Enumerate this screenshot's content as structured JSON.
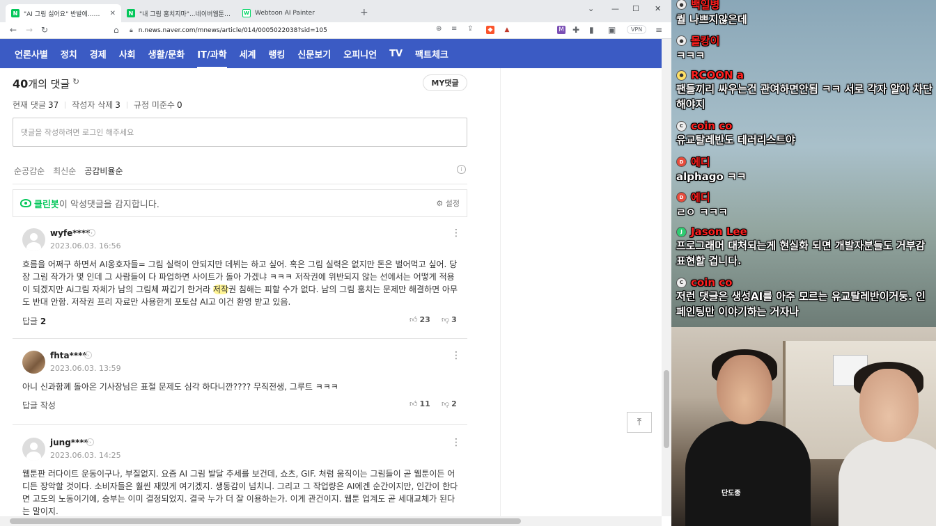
{
  "browser": {
    "tabs": [
      {
        "title": "\"AI 그림 싫어요\" 반발에...네이버 : ",
        "active": true,
        "favicon": "N"
      },
      {
        "title": "\"내 그림 훔치지마\"...네이버웹툰 도전",
        "active": false,
        "favicon": "N"
      },
      {
        "title": "Webtoon AI Painter",
        "active": false,
        "favicon": "W"
      }
    ],
    "url": "n.news.naver.com/mnews/article/014/0005022038?sid=105",
    "vpn_label": "VPN"
  },
  "nav": {
    "items": [
      "언론사별",
      "정치",
      "경제",
      "사회",
      "생활/문화",
      "IT/과학",
      "세계",
      "랭킹",
      "신문보기",
      "오피니언",
      "TV",
      "팩트체크"
    ],
    "active": "IT/과학"
  },
  "comments_panel": {
    "count": "40",
    "count_suffix": "개의 댓글",
    "my_button": "MY댓글",
    "stats": [
      {
        "label": "현재 댓글",
        "value": "37"
      },
      {
        "label": "작성자 삭제",
        "value": "3"
      },
      {
        "label": "규정 미준수",
        "value": "0"
      }
    ],
    "input_placeholder": "댓글을 작성하려면 로그인 해주세요",
    "sort_options": [
      "순공감순",
      "최신순",
      "공감비율순"
    ],
    "sort_active": "공감비율순",
    "cleanbot": {
      "brand": "클린봇",
      "text": "이 악성댓글을 감지합니다.",
      "setting": "설정"
    }
  },
  "comments": [
    {
      "user": "wyfe****",
      "date": "2023.06.03. 16:56",
      "text_before": "흐름을 어쩌구 하면서 AI옹호자들= 그림 실력이 안되지만 데뷔는 하고 싶어. 혹은 그림 실력은 없지만 돈은 벌어먹고 싶어. 당장 그림 작가가 몇 인데 그 사람들이 다 파업하면 사이트가 돌아 가겠냐 ㅋㅋㅋ 저작권에 위반되지 않는 선에서는 어떻게 적용이 되겠지만 Ai그림 자체가 남의 그림체 짜깁기 한거라 ",
      "text_highlight": "저작",
      "text_after": "권 침해는 피할 수가 없다. 남의 그림 훔치는 문제만 해결하면 아무도 반대 안함. 저작권 프리 자료만 사용한게 포토샵 AI고 이건 환영 받고 있음.",
      "reply_label": "답글",
      "reply_count": "2",
      "likes": "23",
      "dislikes": "3"
    },
    {
      "user": "fhta****",
      "date": "2023.06.03. 13:59",
      "text": "아니 신과함께 돌아온 기사장님은 표절 문제도 심각 하다니깐???? 무직전생, 그루트 ㅋㅋㅋ",
      "reply_label": "답글 작성",
      "likes": "11",
      "dislikes": "2"
    },
    {
      "user": "jung****",
      "date": "2023.06.03. 14:25",
      "text": "웹툰판 러다이트 운동이구나, 부질없지. 요즘 AI 그림 발달 추세를 보건데, 쇼츠, GIF. 처럼 움직이는 그림들이 곧 웹툰이든 어디든 장악할 것이다. 소비자들은 훨씬 재밌게 여기겠지. 생동감이 넘치니. 그리고 그 작업량은 AI에겐 순간이지만, 인간이 한다면 고도의 노동이기에, 승부는 이미 결정되었지. 결국 누가 더 잘 이용하는가. 이게 관건이지. 웹툰 업계도 곧 세대교체가 된다는 말이지."
    }
  ],
  "chat": [
    {
      "name": "백일병",
      "text": "퀄 나쁘지않은데"
    },
    {
      "name": "몰캉이",
      "text": "ㅋㅋㅋ"
    },
    {
      "name": "RCOON a",
      "text": "팬들끼리 싸우는건 관여하면안됨 ㅋㅋ 서로 각자 알아 차단해야지"
    },
    {
      "name": "coin co",
      "text": "유교탈레반도 테러리스트야"
    },
    {
      "name": "에디",
      "text": "alphago ㅋㅋ"
    },
    {
      "name": "에디",
      "text": "ㄹㅇ ㅋㅋㅋ"
    },
    {
      "name": "Jason Lee",
      "text": "프로그래머 대처되는게 현실화 되면 개발자분들도 거부감 표현할 겁니다."
    },
    {
      "name": "coin co",
      "text": "저런 댓글은 생성AI를 아주 모르는 유교탈레반이거둥. 인페인팅만 이야기하는 거자나"
    }
  ],
  "webcam": {
    "shirt_logo": "단도종"
  }
}
